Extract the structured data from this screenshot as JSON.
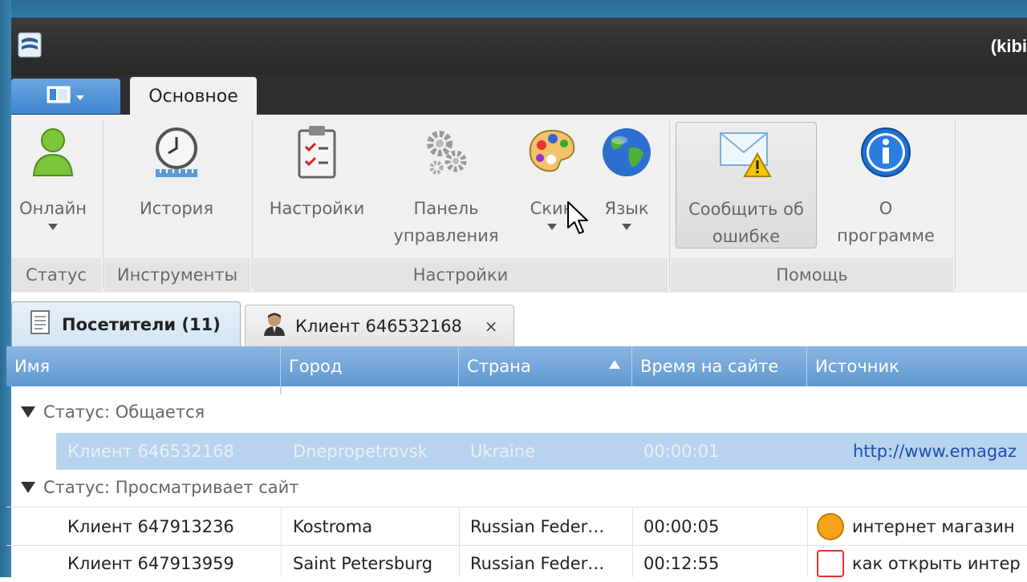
{
  "window": {
    "title": "(kibi"
  },
  "ribbon_tab": "Основное",
  "ribbon": {
    "groups": {
      "status": "Статус",
      "tools": "Инструменты",
      "settings": "Настройки",
      "help": "Помощь"
    },
    "buttons": {
      "online": "Онлайн",
      "history": "История",
      "settings": "Настройки",
      "panel_1": "Панель",
      "panel_2": "управления",
      "skins": "Скин",
      "language": "Язык",
      "report_1": "Сообщить об",
      "report_2": "ошибке",
      "about_1": "О",
      "about_2": "программе"
    }
  },
  "doc_tabs": {
    "visitors": "Посетители (11)",
    "client": "Клиент 646532168",
    "close": "×"
  },
  "table": {
    "columns": [
      "Имя",
      "Город",
      "Страна",
      "Время на сайте",
      "Источник"
    ],
    "groups": [
      {
        "label": "Статус: Общается",
        "rows": [
          {
            "name": "Клиент 646532168",
            "city": "Dnepropetrovsk",
            "country": "Ukraine",
            "time": "00:00:01",
            "source": "http://www.emagaz"
          }
        ]
      },
      {
        "label": "Статус: Просматривает сайт",
        "rows": [
          {
            "name": "Клиент 647913236",
            "city": "Kostroma",
            "country": "Russian Feder…",
            "time": "00:00:05",
            "source": "интернет магазин"
          },
          {
            "name": "Клиент 647913959",
            "city": "Saint Petersburg",
            "country": "Russian Feder…",
            "time": "00:12:55",
            "source": "как открыть интер"
          }
        ]
      }
    ]
  },
  "colors": {
    "accent": "#5f97cf",
    "selection": "#b8d3ee",
    "titlebar": "#2e2e2e"
  }
}
